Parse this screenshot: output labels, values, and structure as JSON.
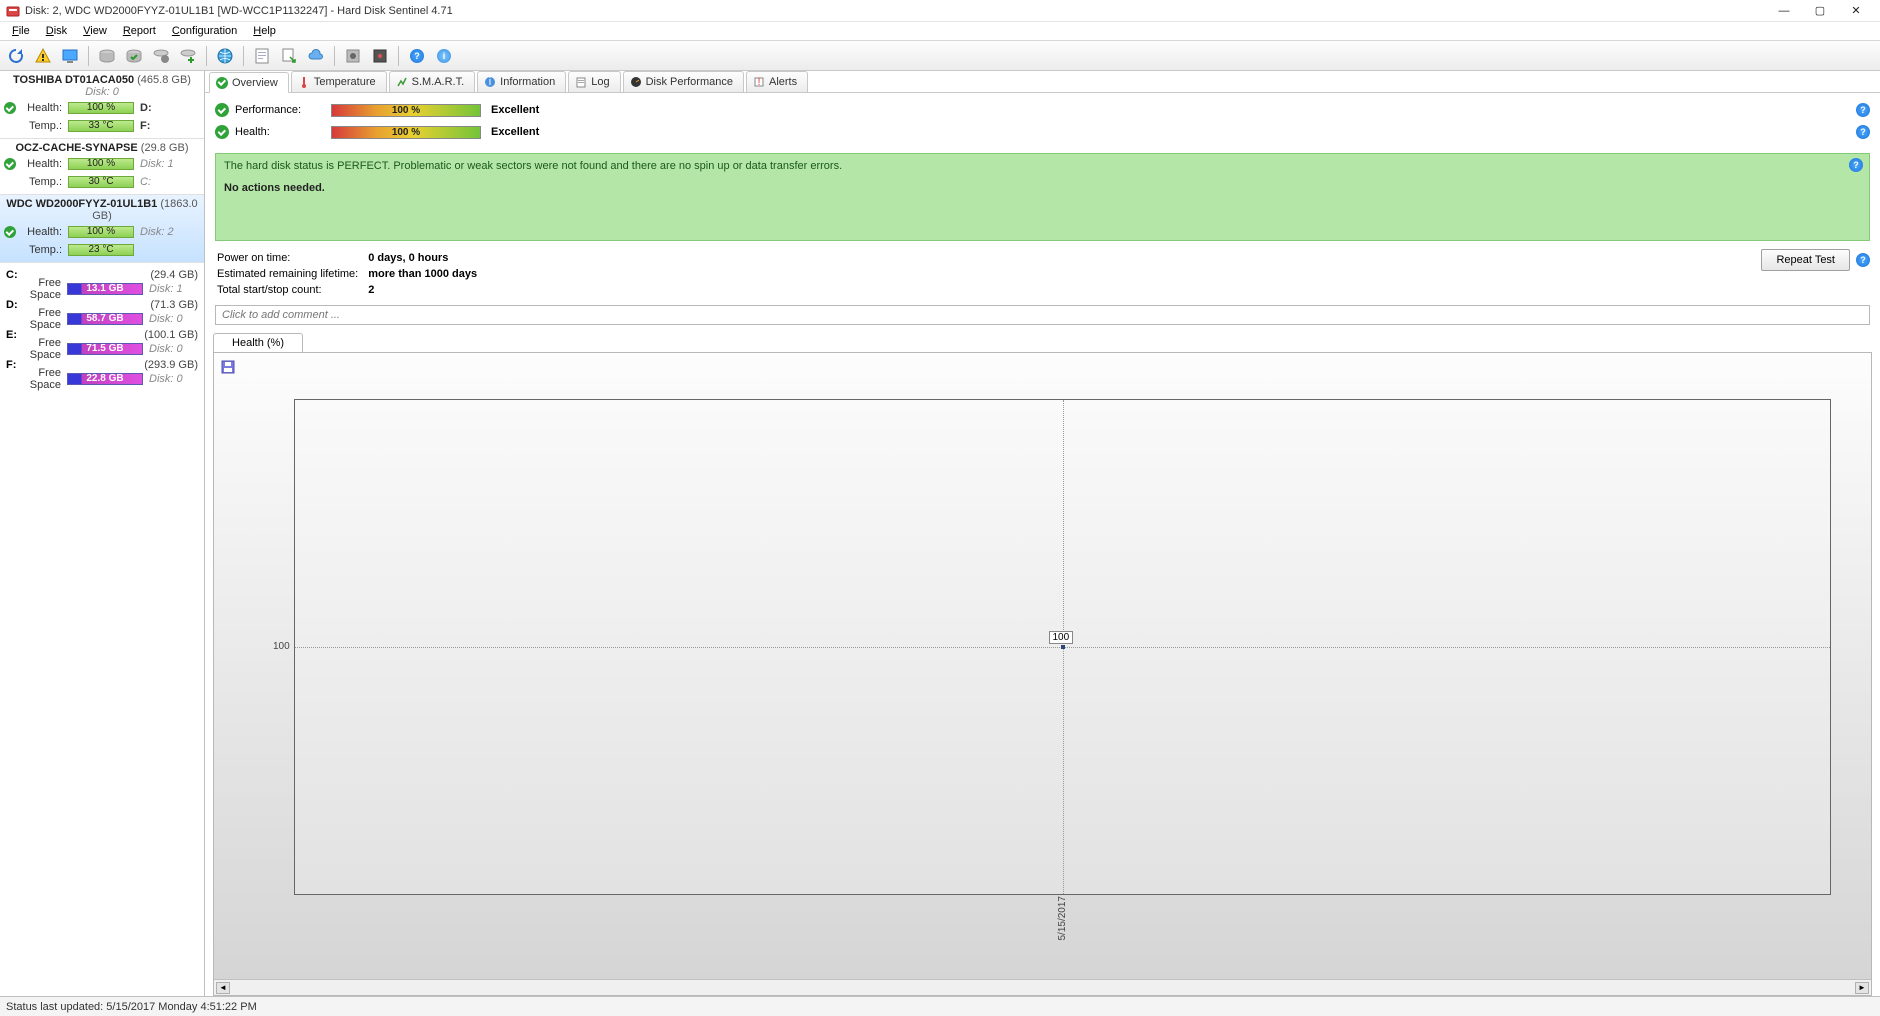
{
  "window": {
    "title": "Disk: 2, WDC WD2000FYYZ-01UL1B1 [WD-WCC1P1132247]  -  Hard Disk Sentinel 4.71",
    "minimize": "—",
    "maximize": "▢",
    "close": "✕"
  },
  "menu": {
    "file": "File",
    "disk": "Disk",
    "view": "View",
    "report": "Report",
    "configuration": "Configuration",
    "help": "Help"
  },
  "sidebar": {
    "disks": [
      {
        "name": "TOSHIBA DT01ACA050",
        "size": "(465.8 GB)",
        "disknum": "Disk: 0",
        "health_label": "Health:",
        "health_value": "100 %",
        "right1": "D:",
        "temp_label": "Temp.:",
        "temp_value": "33 °C",
        "right2": "F:",
        "selected": false
      },
      {
        "name": "OCZ-CACHE-SYNAPSE",
        "size": "(29.8 GB)",
        "disknum": "",
        "health_label": "Health:",
        "health_value": "100 %",
        "right1": "Disk: 1",
        "temp_label": "Temp.:",
        "temp_value": "30 °C",
        "right2": "C:",
        "selected": false
      },
      {
        "name": "WDC WD2000FYYZ-01UL1B1",
        "size": "(1863.0 GB)",
        "disknum": "",
        "health_label": "Health:",
        "health_value": "100 %",
        "right1": "Disk: 2",
        "temp_label": "Temp.:",
        "temp_value": "23 °C",
        "right2": "",
        "selected": true
      }
    ],
    "volumes": [
      {
        "drive": "C:",
        "capacity": "(29.4 GB)",
        "fs": "Free Space",
        "free": "13.1 GB",
        "disknum": "Disk: 1"
      },
      {
        "drive": "D:",
        "capacity": "(71.3 GB)",
        "fs": "Free Space",
        "free": "58.7 GB",
        "disknum": "Disk: 0"
      },
      {
        "drive": "E:",
        "capacity": "(100.1 GB)",
        "fs": "Free Space",
        "free": "71.5 GB",
        "disknum": "Disk: 0"
      },
      {
        "drive": "F:",
        "capacity": "(293.9 GB)",
        "fs": "Free Space",
        "free": "22.8 GB",
        "disknum": "Disk: 0"
      }
    ]
  },
  "tabs": {
    "overview": "Overview",
    "temperature": "Temperature",
    "smart": "S.M.A.R.T.",
    "information": "Information",
    "log": "Log",
    "performance": "Disk Performance",
    "alerts": "Alerts"
  },
  "overview": {
    "perf_label": "Performance:",
    "perf_value": "100 %",
    "perf_rating": "Excellent",
    "health_label": "Health:",
    "health_value": "100 %",
    "health_rating": "Excellent"
  },
  "status": {
    "line1": "The hard disk status is PERFECT. Problematic or weak sectors were not found and there are no spin up or data transfer errors.",
    "line2": "No actions needed."
  },
  "stats": {
    "pot_label": "Power on time:",
    "pot_value": "0 days, 0 hours",
    "erl_label": "Estimated remaining lifetime:",
    "erl_value": "more than 1000 days",
    "ssc_label": "Total start/stop count:",
    "ssc_value": "2",
    "repeat": "Repeat Test"
  },
  "comment": {
    "placeholder": "Click to add comment ..."
  },
  "chart": {
    "tab": "Health (%)",
    "ylabel": "100",
    "point_label": "100",
    "xlabel": "5/15/2017"
  },
  "statusbar": {
    "text": "Status last updated: 5/15/2017 Monday 4:51:22 PM"
  },
  "chart_data": {
    "type": "line",
    "title": "Health (%)",
    "x": [
      "5/15/2017"
    ],
    "y": [
      100
    ],
    "xlabel": "",
    "ylabel": "",
    "ylim": [
      0,
      200
    ]
  }
}
